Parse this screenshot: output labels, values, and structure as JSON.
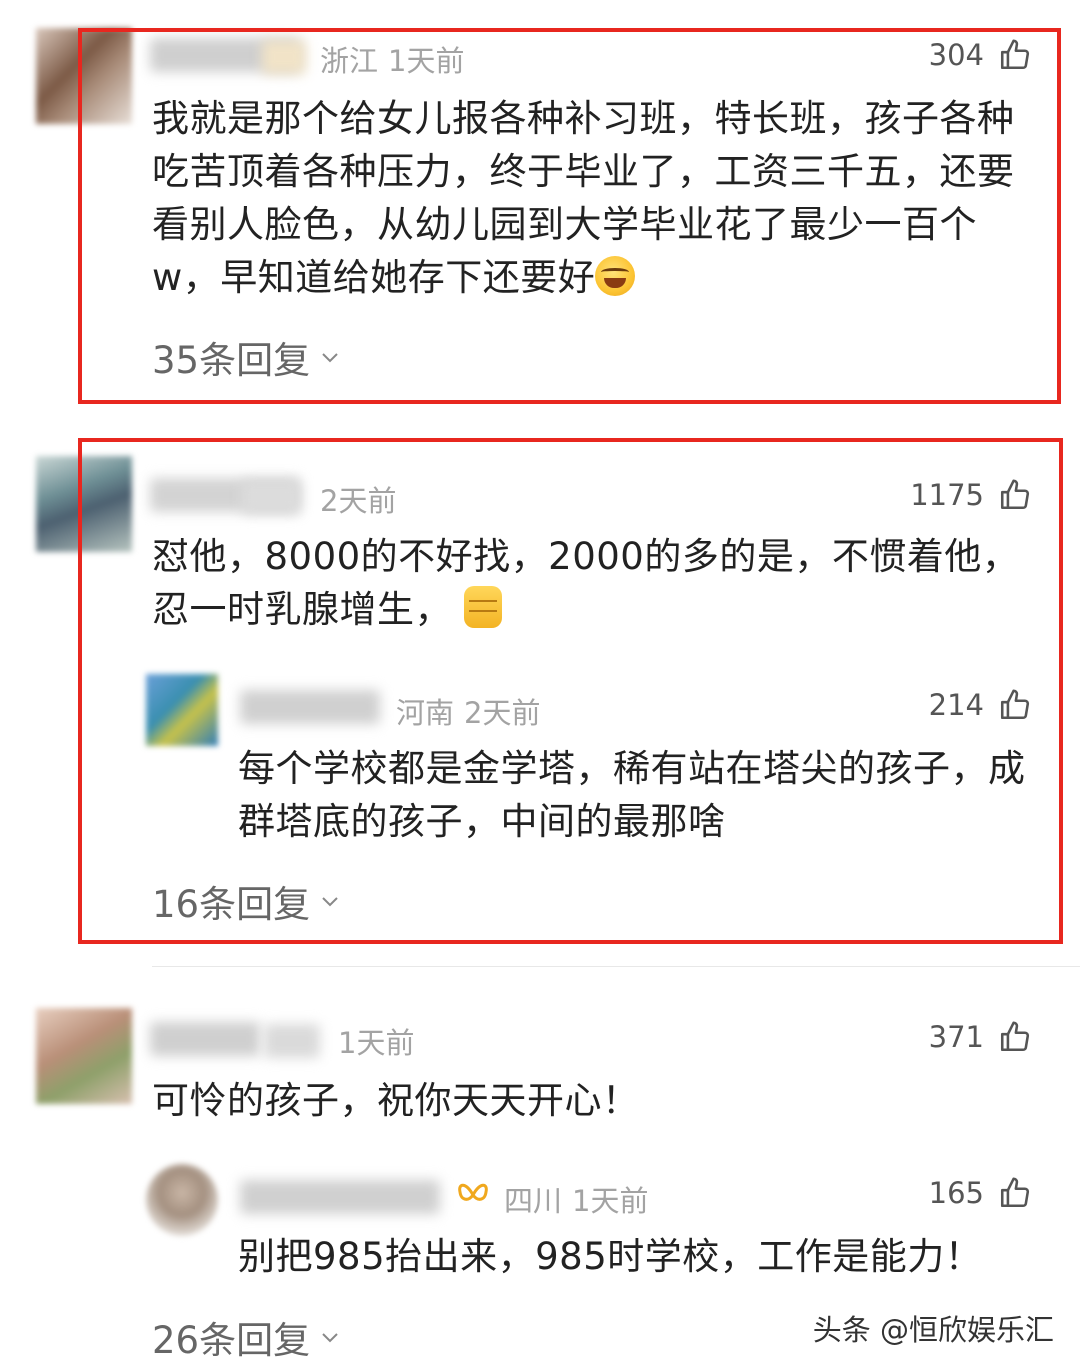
{
  "comments": [
    {
      "region": "浙江",
      "time": "1天前",
      "likes": "304",
      "text": "我就是那个给女儿报各种补习班，特长班，孩子各种吃苦顶着各种压力，终于毕业了，工资三千五，还要看别人脸色，从幼儿园到大学毕业花了最少一百个w，早知道给她存下还要好",
      "emoji": "laughing-crying-emoji",
      "reply_count": "35条回复"
    },
    {
      "region": "",
      "time": "2天前",
      "likes": "1175",
      "text": "怼他，8000的不好找，2000的多的是，不惯着他，忍一时乳腺增生，",
      "emoji": "fist-emoji",
      "sub_reply": {
        "region": "河南",
        "time": "2天前",
        "likes": "214",
        "text": "每个学校都是金学塔，稀有站在塔尖的孩子，成群塔底的孩子，中间的最那啥"
      },
      "reply_count": "16条回复"
    },
    {
      "region": "",
      "time": "1天前",
      "likes": "371",
      "text": "可怜的孩子，祝你天天开心！",
      "sub_reply": {
        "region": "四川",
        "time": "1天前",
        "likes": "165",
        "text": "别把985抬出来，985时学校，工作是能力！"
      },
      "reply_count": "26条回复"
    }
  ],
  "watermark": {
    "text": "头条 @恒欣娱乐汇"
  },
  "colors": {
    "highlight_box": "#e8271f",
    "meta_text": "#a3a3a3",
    "body_text": "#222222"
  },
  "icons": {
    "like": "thumbs-up-icon",
    "expand": "chevron-down-icon",
    "vip_badge": "butterfly-badge-icon"
  }
}
